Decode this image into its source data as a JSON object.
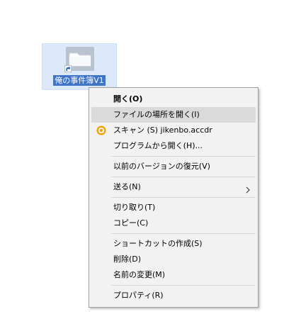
{
  "desktop_icon": {
    "label": "俺の事件簿V1",
    "icon": "folder-icon",
    "overlay": "shortcut-arrow-icon",
    "selected": true
  },
  "context_menu": {
    "items": [
      {
        "label": "開く(O)",
        "bold": true
      },
      {
        "label": "ファイルの場所を開く(I)",
        "highlighted": true
      },
      {
        "label": "スキャン (S) jikenbo.accdr",
        "icon": "antivirus-scan-icon",
        "icon_color": "#f5a000"
      },
      {
        "label": "プログラムから開く(H)..."
      },
      {
        "label": "以前のバージョンの復元(V)"
      },
      {
        "label": "送る(N)",
        "submenu": true
      },
      {
        "label": "切り取り(T)"
      },
      {
        "label": "コピー(C)"
      },
      {
        "label": "ショートカットの作成(S)"
      },
      {
        "label": "削除(D)"
      },
      {
        "label": "名前の変更(M)"
      },
      {
        "label": "プロパティ(R)"
      }
    ]
  },
  "colors": {
    "selection_bg": "#dbe9fb",
    "label_highlight": "#3f74c8",
    "menu_bg": "#f2f2f2",
    "menu_hover": "#dadada",
    "menu_border": "#a0a0a0"
  }
}
